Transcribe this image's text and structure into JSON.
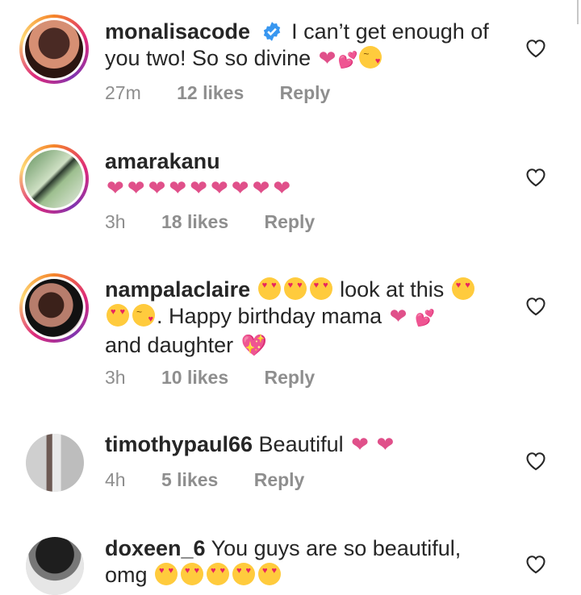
{
  "comments": [
    {
      "username": "monalisacode",
      "verified": true,
      "text": "I can’t get enough of you two! So so divine",
      "time": "27m",
      "likes": "12 likes",
      "reply": "Reply"
    },
    {
      "username": "amarakanu",
      "text": "",
      "time": "3h",
      "likes": "18 likes",
      "reply": "Reply"
    },
    {
      "username": "nampalaclaire",
      "text_a": "look at this",
      "text_b": ". Happy birthday mama",
      "text_c": "and daughter",
      "time": "3h",
      "likes": "10 likes",
      "reply": "Reply"
    },
    {
      "username": "timothypaul66",
      "text": "Beautiful",
      "time": "4h",
      "likes": "5 likes",
      "reply": "Reply"
    },
    {
      "username": "doxeen_6",
      "text": "You guys are so beautiful,",
      "text2": "omg"
    }
  ],
  "colors": {
    "heart": "#e0508a",
    "meta": "#8e8e8e",
    "verified": "#3897f0"
  },
  "icons": [
    "verified-badge-icon",
    "heart-outline-icon",
    "heart-emoji-icon",
    "heart-eyes-emoji-icon",
    "kiss-emoji-icon"
  ]
}
